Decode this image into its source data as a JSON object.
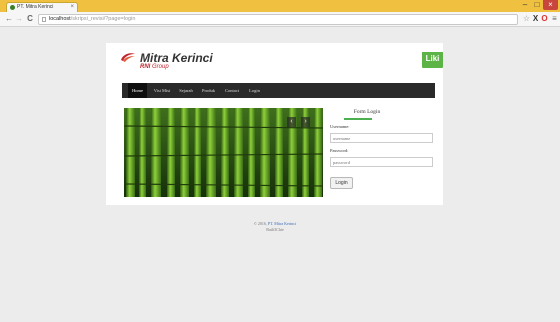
{
  "browser": {
    "tab_title": "PT. Mitra Kerinci",
    "tab_close": "×",
    "url_host": "localhost",
    "url_path": "/skripsi_revisi/?page=login",
    "window_controls": {
      "minimize": "–",
      "maximize": "□",
      "close": "×"
    },
    "nav": {
      "back": "←",
      "forward": "→",
      "reload": "C"
    },
    "icons": {
      "star": "☆",
      "ext_x": "X",
      "ext_o": "O",
      "menu": "≡"
    }
  },
  "header": {
    "logo_text": "Mitra Kerinci",
    "logo_sub_bold": "RNI",
    "logo_sub_rest": " Group",
    "liki_label": "Liki"
  },
  "navbar": {
    "items": [
      {
        "label": "Home",
        "active": true
      },
      {
        "label": "Visi Misi",
        "active": false
      },
      {
        "label": "Sejarah",
        "active": false
      },
      {
        "label": "Produk",
        "active": false
      },
      {
        "label": "Contact",
        "active": false
      },
      {
        "label": "Login",
        "active": false
      }
    ]
  },
  "slider": {
    "prev": "‹",
    "next": "›"
  },
  "login_form": {
    "title": "Form Login",
    "username_label": "Username:",
    "username_placeholder": "username",
    "password_label": "Password:",
    "password_placeholder": "password",
    "submit_label": "Login"
  },
  "footer": {
    "copyright": "© 2016,",
    "company_link": "PT. Mitra Kerinci",
    "built_with": "Built3Chie"
  },
  "colors": {
    "browser_frame": "#f0c040",
    "navbar_bg": "#2a2a2a",
    "accent_green": "#4caf50",
    "liki_green": "#5db446",
    "brand_red": "#c0262e"
  }
}
